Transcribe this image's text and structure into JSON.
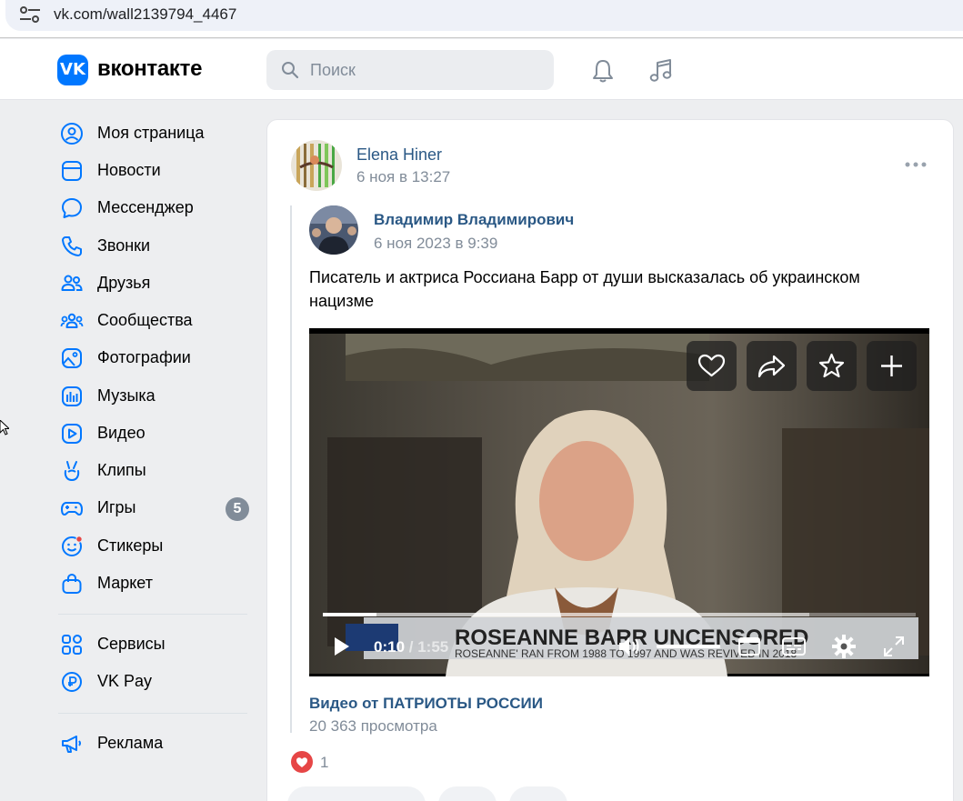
{
  "browser": {
    "url": "vk.com/wall2139794_4467"
  },
  "header": {
    "logo_letters": "VK",
    "logo_text": "вконтакте",
    "search_placeholder": "Поиск"
  },
  "sidebar": {
    "items": [
      {
        "label": "Моя страница",
        "icon": "user-circle-icon"
      },
      {
        "label": "Новости",
        "icon": "news-icon"
      },
      {
        "label": "Мессенджер",
        "icon": "message-icon"
      },
      {
        "label": "Звонки",
        "icon": "phone-icon"
      },
      {
        "label": "Друзья",
        "icon": "friends-icon"
      },
      {
        "label": "Сообщества",
        "icon": "communities-icon"
      },
      {
        "label": "Фотографии",
        "icon": "photo-icon"
      },
      {
        "label": "Музыка",
        "icon": "music-bars-icon"
      },
      {
        "label": "Видео",
        "icon": "video-icon"
      },
      {
        "label": "Клипы",
        "icon": "clips-icon"
      },
      {
        "label": "Игры",
        "icon": "gamepad-icon",
        "badge": "5"
      },
      {
        "label": "Стикеры",
        "icon": "sticker-icon"
      },
      {
        "label": "Маркет",
        "icon": "market-bag-icon"
      },
      {
        "label": "Сервисы",
        "icon": "services-grid-icon"
      },
      {
        "label": "VK Pay",
        "icon": "vkpay-icon"
      },
      {
        "label": "Реклама",
        "icon": "megaphone-icon"
      }
    ]
  },
  "post": {
    "author": "Elena Hiner",
    "date": "6 ноя в 13:27",
    "repost": {
      "author": "Владимир Владимирович",
      "date": "6 ноя 2023 в 9:39",
      "text": "Писатель и актриса Россиана Барр от души высказалась об украинском нацизме"
    },
    "video": {
      "caption_top": "ROSEANNE BARR UNCENSORED",
      "caption_sub": "ROSEANNE' RAN FROM 1988 TO 1997 AND WAS REVIVED IN 2018",
      "current_time": "0:10",
      "duration": "/ 1:55",
      "progress_fraction": 0.09,
      "buffered_fraction": 0.82,
      "volume_fraction": 1.0
    },
    "video_source": "Видео от ПАТРИОТЫ РОССИИ",
    "views": "20 363 просмотра",
    "likes": "1"
  },
  "colors": {
    "accent": "#0077ff",
    "link": "#2a5885",
    "muted": "#818c99",
    "like": "#e64646"
  }
}
